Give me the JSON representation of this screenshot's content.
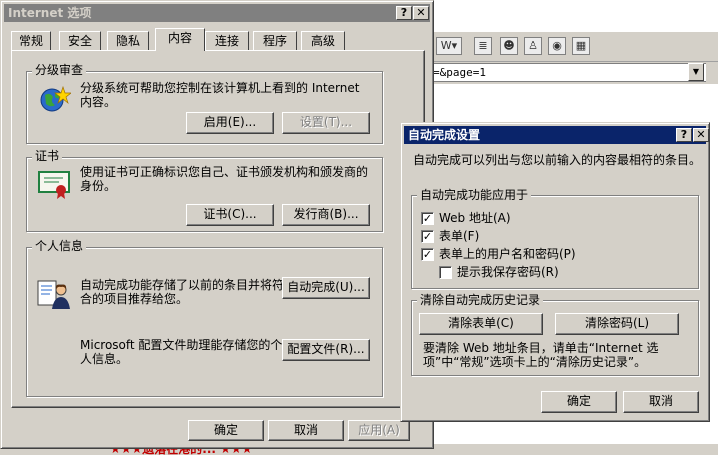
{
  "background_browser": {
    "address_text": "=&page=1",
    "bottom_text": "★★★遗落在港的... ★★★"
  },
  "internet_options": {
    "title": "Internet 选项",
    "help_btn": "?",
    "close_btn": "✕",
    "tabs": [
      "常规",
      "安全",
      "隐私",
      "内容",
      "连接",
      "程序",
      "高级"
    ],
    "selected_tab": "内容",
    "content_advisor": {
      "group_label": "分级审查",
      "description": "分级系统可帮助您控制在该计算机上看到的 Internet 内容。",
      "enable_button": "启用(E)...",
      "settings_button": "设置(T)..."
    },
    "certificates": {
      "group_label": "证书",
      "description": "使用证书可正确标识您自己、证书颁发机构和颁发商的身份。",
      "certificates_button": "证书(C)...",
      "publishers_button": "发行商(B)..."
    },
    "personal_info": {
      "group_label": "个人信息",
      "autocomplete_description": "自动完成功能存储了以前的条目并将符合的项目推荐给您。",
      "autocomplete_button": "自动完成(U)...",
      "profile_description": "Microsoft 配置文件助理能存储您的个人信息。",
      "profile_button": "配置文件(R)..."
    },
    "ok_button": "确定",
    "cancel_button": "取消",
    "apply_button": "应用(A)"
  },
  "autocomplete_settings": {
    "title": "自动完成设置",
    "help_btn": "?",
    "close_btn": "✕",
    "intro": "自动完成可以列出与您以前输入的内容最相符的条目。",
    "use_for_group": "自动完成功能应用于",
    "options": [
      {
        "label": "Web 地址(A)",
        "checked": true
      },
      {
        "label": "表单(F)",
        "checked": true
      },
      {
        "label": "表单上的用户名和密码(P)",
        "checked": true
      },
      {
        "label": "提示我保存密码(R)",
        "checked": false
      }
    ],
    "clear_group": "清除自动完成历史记录",
    "clear_forms_button": "清除表单(C)",
    "clear_passwords_button": "清除密码(L)",
    "clear_note": "要清除 Web 地址条目，请单击“Internet 选项”中“常规”选项卡上的“清除历史记录”。",
    "ok_button": "确定",
    "cancel_button": "取消"
  }
}
